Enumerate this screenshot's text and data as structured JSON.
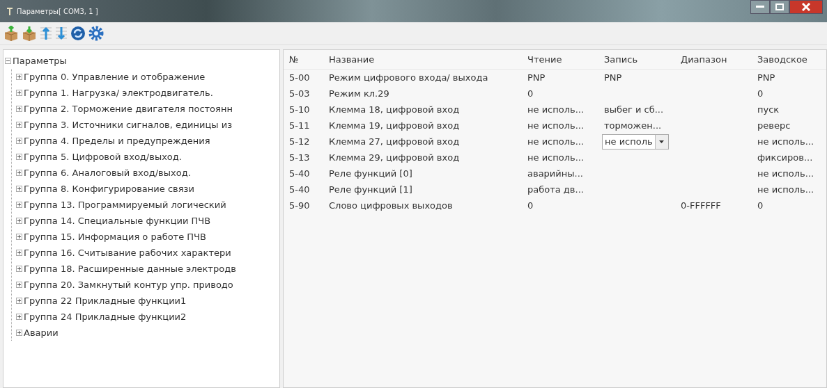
{
  "window": {
    "title": "Параметры[ COM3, 1 ]"
  },
  "tree": {
    "label": "Параметры",
    "expanded": true,
    "children": [
      {
        "label": "Группа 0. Управление и отображение",
        "expanded": false
      },
      {
        "label": "Группа 1. Нагрузка/ электродвигатель.",
        "expanded": false
      },
      {
        "label": "Группа 2. Торможение двигателя постоянн",
        "expanded": false
      },
      {
        "label": "Группа 3. Источники сигналов, единицы из",
        "expanded": false
      },
      {
        "label": "Группа 4. Пределы и предупреждения",
        "expanded": false
      },
      {
        "label": "Группа 5. Цифровой вход/выход.",
        "expanded": false
      },
      {
        "label": "Группа 6. Аналоговый вход/выход.",
        "expanded": false
      },
      {
        "label": "Группа 8. Конфигурирование связи",
        "expanded": false
      },
      {
        "label": "Группа 13. Программируемый логический",
        "expanded": false
      },
      {
        "label": "Группа 14. Специальные функции ПЧВ",
        "expanded": false
      },
      {
        "label": "Группа 15. Информация о работе ПЧВ",
        "expanded": false
      },
      {
        "label": "Группа 16. Считывание рабочих характери",
        "expanded": false
      },
      {
        "label": "Группа 18. Расширенные данные электродв",
        "expanded": false
      },
      {
        "label": "Группа 20. Замкнутый контур упр. приводо",
        "expanded": false
      },
      {
        "label": "Группа 22 Прикладные функции1",
        "expanded": false
      },
      {
        "label": "Группа 24 Прикладные функции2",
        "expanded": false
      },
      {
        "label": "Аварии",
        "expanded": false
      }
    ]
  },
  "table": {
    "columns": [
      "№",
      "Название",
      "Чтение",
      "Запись",
      "Диапазон",
      "Заводское"
    ],
    "rows": [
      {
        "number": "5-00",
        "name": "Режим цифрового входа/ выхода",
        "read": "PNP",
        "write": "PNP",
        "default": "PNP",
        "editing": false
      },
      {
        "number": "5-03",
        "name": "Режим кл.29",
        "read": "0",
        "default": "0",
        "editing": false
      },
      {
        "number": "5-10",
        "name": "Клемма 18, цифровой вход",
        "read": "не исполь...",
        "write": "выбег и сб...",
        "default": "пуск",
        "editing": false
      },
      {
        "number": "5-11",
        "name": "Клемма 19, цифровой вход",
        "read": "не исполь...",
        "write": "торможен...",
        "default": "реверс",
        "editing": false
      },
      {
        "number": "5-12",
        "name": "Клемма 27, цифровой вход",
        "read": "не исполь...",
        "write": "не исполь",
        "default": "не исполь...",
        "editing": true
      },
      {
        "number": "5-13",
        "name": "Клемма 29, цифровой вход",
        "read": "не исполь...",
        "default": "фиксиров...",
        "editing": false
      },
      {
        "number": "5-40",
        "name": "Реле функций [0]",
        "read": "аварийны...",
        "default": "не исполь...",
        "editing": false
      },
      {
        "number": "5-40",
        "name": "Реле функций [1]",
        "read": "работа дв...",
        "default": "не исполь...",
        "editing": false
      },
      {
        "number": "5-90",
        "name": "Слово цифровых выходов",
        "read": "0",
        "range": "0-FFFFFF",
        "default": "0",
        "editing": false
      }
    ]
  }
}
